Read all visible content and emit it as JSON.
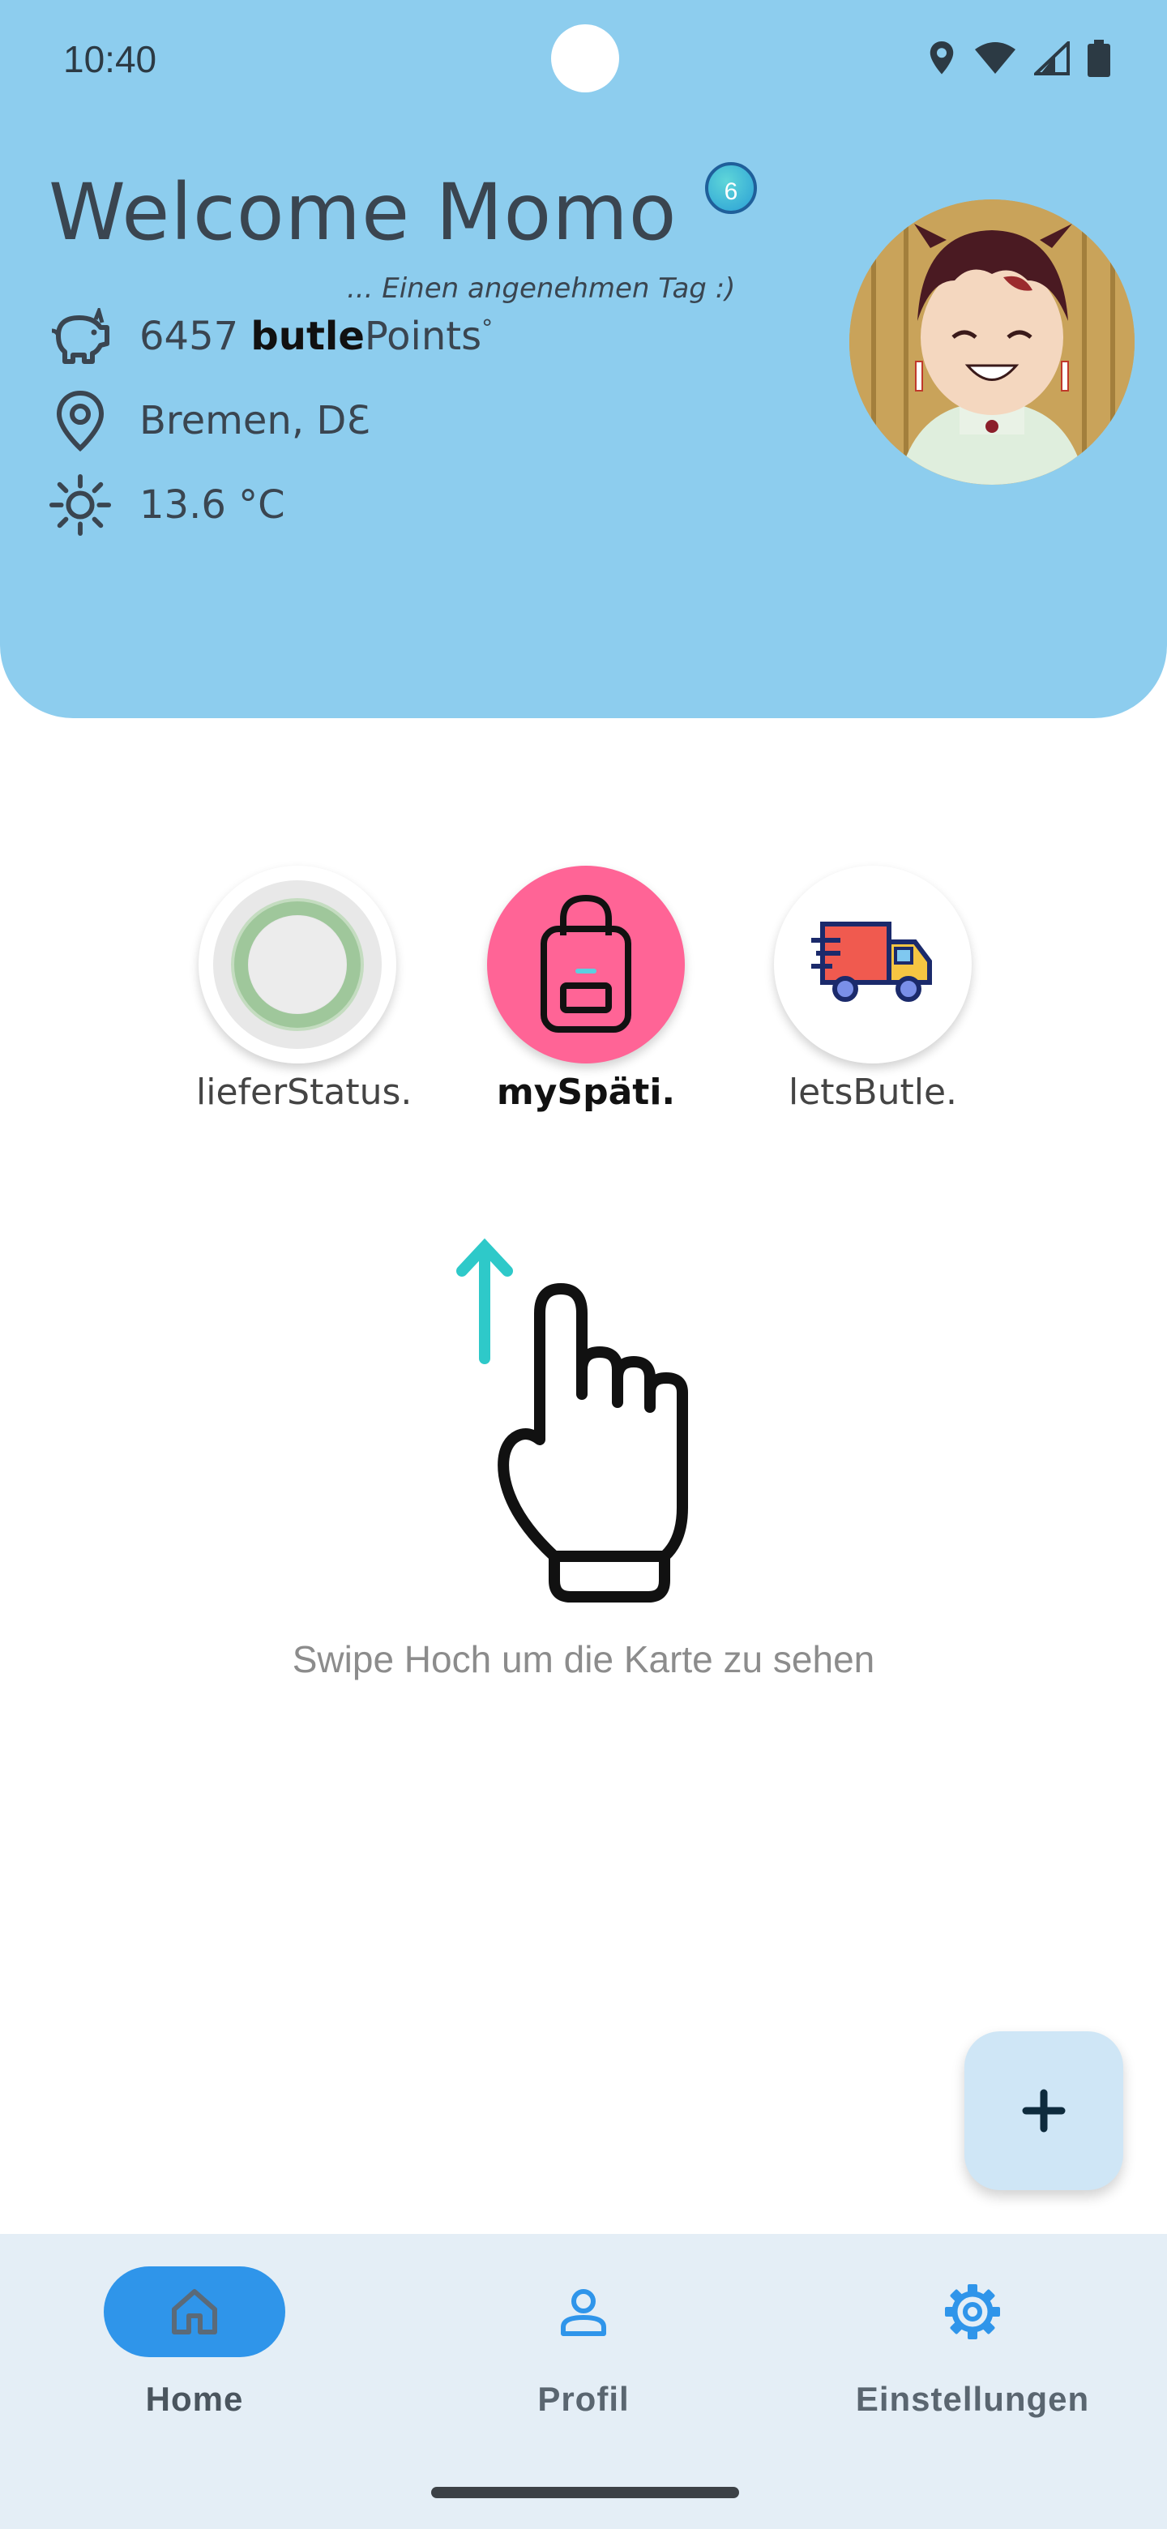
{
  "status_bar": {
    "time": "10:40"
  },
  "header": {
    "welcome": "Welcome Momo",
    "level": "6",
    "greeting": "... Einen angenehmen Tag :)",
    "points_value": "6457",
    "points_brand": "butle",
    "points_suffix": "Points",
    "points_degree": "°",
    "location": "Bremen, DƐ",
    "temperature": "13.6 °C"
  },
  "quick_actions": [
    {
      "label": "lieferStatus."
    },
    {
      "label": "mySpäti."
    },
    {
      "label": "letsButle."
    }
  ],
  "swipe_hint": "Swipe Hoch um die Karte zu sehen",
  "fab": {
    "icon": "plus-icon"
  },
  "bottom_nav": [
    {
      "label": "Home",
      "icon": "home-icon",
      "active": true
    },
    {
      "label": "Profil",
      "icon": "person-icon",
      "active": false
    },
    {
      "label": "Einstellungen",
      "icon": "gear-icon",
      "active": false
    }
  ],
  "colors": {
    "header_bg": "#8dcdee",
    "myspaeti_pink": "#ff6496",
    "nav_active": "#2f95ea",
    "arrow_teal": "#2ec9c9"
  }
}
